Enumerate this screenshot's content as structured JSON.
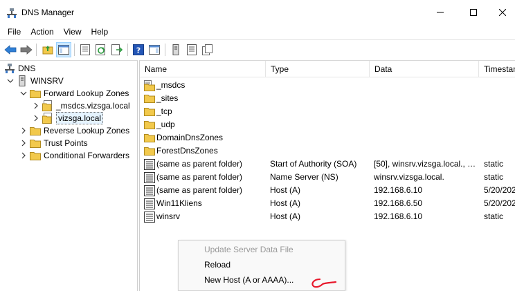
{
  "window": {
    "title": "DNS Manager"
  },
  "menu": [
    {
      "label": "File"
    },
    {
      "label": "Action"
    },
    {
      "label": "View"
    },
    {
      "label": "Help"
    }
  ],
  "tree": [
    {
      "label": "DNS",
      "icon": "dns-server-icon",
      "level": 0,
      "expander": ""
    },
    {
      "label": "WINSRV",
      "icon": "server-icon",
      "level": 1,
      "expander": "expanded"
    },
    {
      "label": "Forward Lookup Zones",
      "icon": "folder-icon",
      "level": 2,
      "expander": "expanded"
    },
    {
      "label": "_msdcs.vizsga.local",
      "icon": "zone-icon",
      "level": 3,
      "expander": "collapsed"
    },
    {
      "label": "vizsga.local",
      "icon": "zone-icon",
      "level": 3,
      "expander": "collapsed",
      "selected": true
    },
    {
      "label": "Reverse Lookup Zones",
      "icon": "folder-icon",
      "level": 2,
      "expander": "collapsed"
    },
    {
      "label": "Trust Points",
      "icon": "folder-icon",
      "level": 2,
      "expander": "collapsed"
    },
    {
      "label": "Conditional Forwarders",
      "icon": "folder-icon",
      "level": 2,
      "expander": "collapsed"
    }
  ],
  "list": {
    "columns": [
      "Name",
      "Type",
      "Data",
      "Timestamp"
    ],
    "rows": [
      {
        "name": "_msdcs",
        "type": "",
        "data": "",
        "timestamp": "",
        "icon": "delegation-folder-icon"
      },
      {
        "name": "_sites",
        "type": "",
        "data": "",
        "timestamp": "",
        "icon": "folder-icon"
      },
      {
        "name": "_tcp",
        "type": "",
        "data": "",
        "timestamp": "",
        "icon": "folder-icon"
      },
      {
        "name": "_udp",
        "type": "",
        "data": "",
        "timestamp": "",
        "icon": "folder-icon"
      },
      {
        "name": "DomainDnsZones",
        "type": "",
        "data": "",
        "timestamp": "",
        "icon": "folder-icon"
      },
      {
        "name": "ForestDnsZones",
        "type": "",
        "data": "",
        "timestamp": "",
        "icon": "folder-icon"
      },
      {
        "name": "(same as parent folder)",
        "type": "Start of Authority (SOA)",
        "data": "[50], winsrv.vizsga.local., h...",
        "timestamp": "static",
        "icon": "record-icon"
      },
      {
        "name": "(same as parent folder)",
        "type": "Name Server (NS)",
        "data": "winsrv.vizsga.local.",
        "timestamp": "static",
        "icon": "record-icon"
      },
      {
        "name": "(same as parent folder)",
        "type": "Host (A)",
        "data": "192.168.6.10",
        "timestamp": "5/20/202",
        "icon": "record-icon"
      },
      {
        "name": "Win11Kliens",
        "type": "Host (A)",
        "data": "192.168.6.50",
        "timestamp": "5/20/202",
        "icon": "record-icon"
      },
      {
        "name": "winsrv",
        "type": "Host (A)",
        "data": "192.168.6.10",
        "timestamp": "static",
        "icon": "record-icon"
      }
    ]
  },
  "context_menu": [
    {
      "label": "Update Server Data File",
      "disabled": true
    },
    {
      "label": "Reload",
      "disabled": false
    },
    {
      "label": "New Host (A or AAAA)...",
      "disabled": false
    }
  ],
  "colors": {
    "selection": "#e5f3ff",
    "toolbar_active": "#cce8ff",
    "folder": "#f2c94c",
    "annotation": "#e8192c"
  }
}
